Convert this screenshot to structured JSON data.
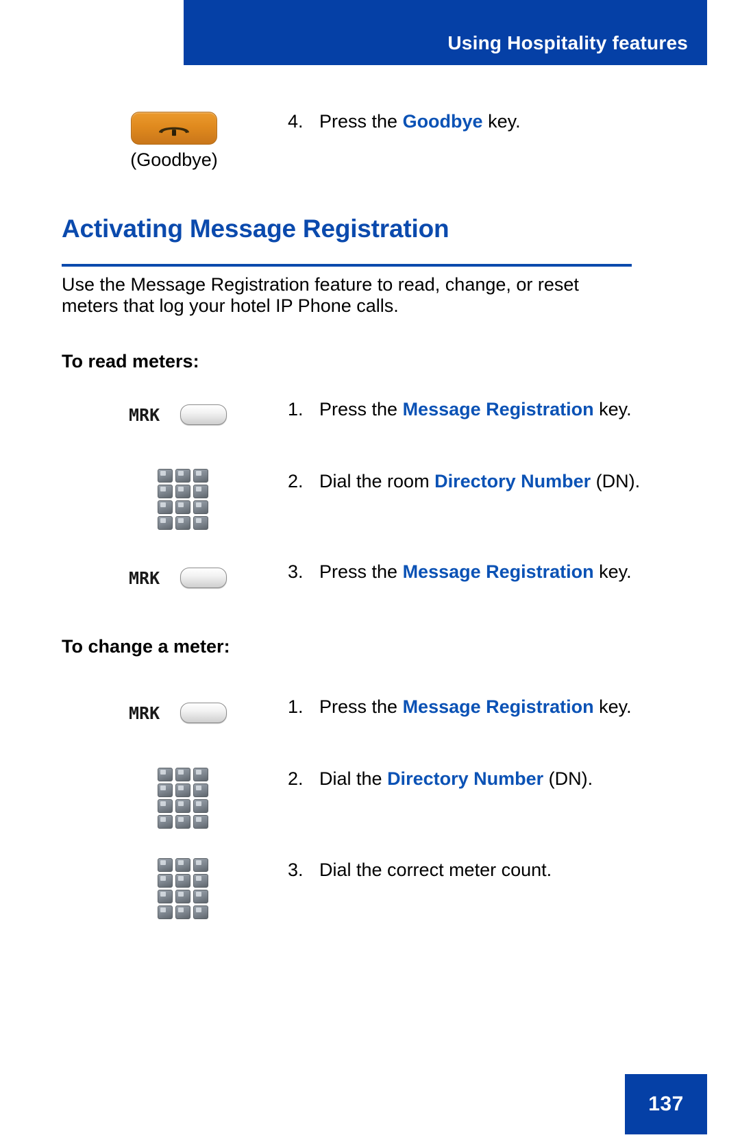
{
  "header": {
    "title": "Using Hospitality features",
    "band_color": "#0540a6"
  },
  "goodbye_block": {
    "caption": "(Goodbye)",
    "key_color": "#e08a1e",
    "icon": "telephone-handset-on-cradle",
    "step": {
      "number": "4.",
      "before": "Press the ",
      "keyword": "Goodbye",
      "after": " key."
    }
  },
  "section": {
    "heading": "Activating Message Registration",
    "heading_color": "#0b4aad",
    "body": "Use the Message Registration feature to read, change, or reset meters that log your hotel IP Phone calls."
  },
  "subsections": [
    {
      "title": "To read meters:",
      "steps": [
        {
          "number": "1.",
          "before": "Press the ",
          "keyword": "Message Registration",
          "after": " key.",
          "icon": "mrk-feature-key",
          "icon_label": "MRK"
        },
        {
          "number": "2.",
          "before": "Dial the room ",
          "keyword": "Directory Number",
          "after": " (DN).",
          "icon": "dialpad-keypad",
          "icon_label": ""
        },
        {
          "number": "3.",
          "before": "Press the ",
          "keyword": "Message Registration",
          "after": " key.",
          "icon": "mrk-feature-key",
          "icon_label": "MRK"
        }
      ]
    },
    {
      "title": "To change a meter:",
      "steps": [
        {
          "number": "1.",
          "before": "Press the ",
          "keyword": "Message Registration",
          "after": " key.",
          "icon": "mrk-feature-key",
          "icon_label": "MRK"
        },
        {
          "number": "2.",
          "before": "Dial the ",
          "keyword": "Directory Number",
          "after": " (DN).",
          "icon": "dialpad-keypad",
          "icon_label": ""
        },
        {
          "number": "3.",
          "before": "Dial the correct meter count.",
          "keyword": "",
          "after": "",
          "icon": "dialpad-keypad",
          "icon_label": ""
        }
      ]
    }
  ],
  "footer": {
    "page_number": "137",
    "box_color": "#0540a6"
  }
}
